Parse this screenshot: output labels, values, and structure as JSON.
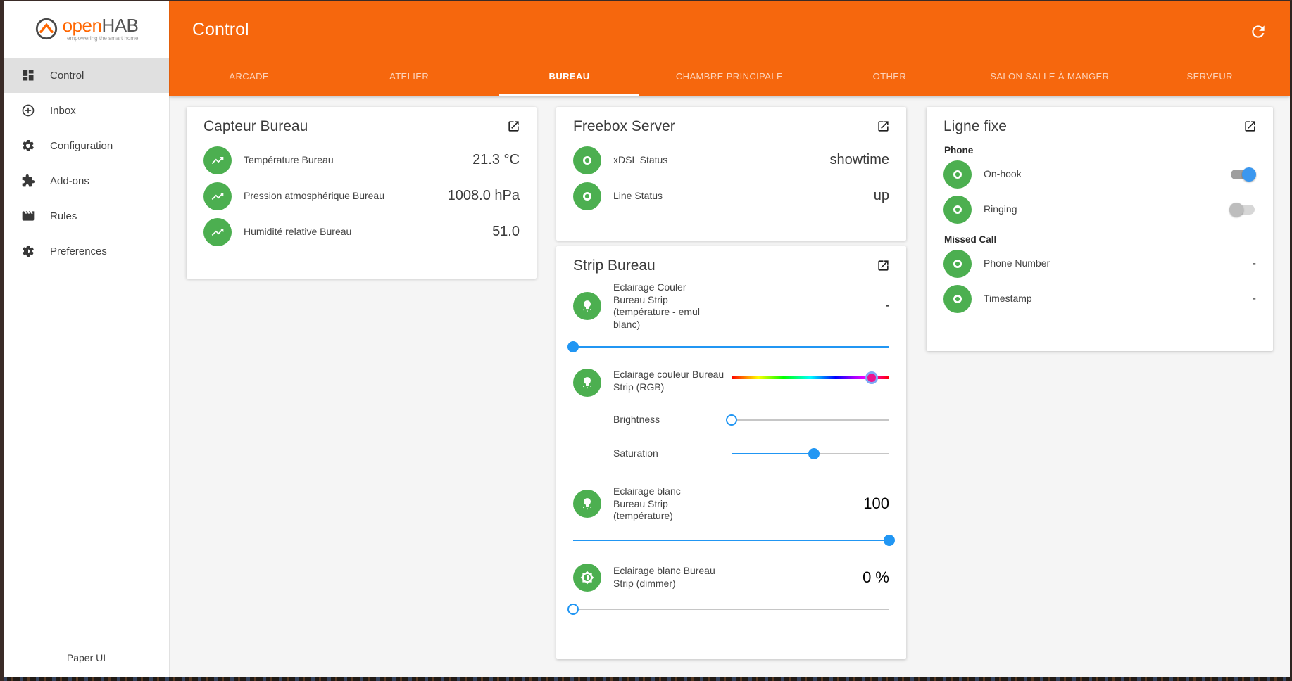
{
  "sidebar": {
    "logo": {
      "text_primary": "open",
      "text_secondary": "HAB",
      "tagline": "empowering the smart home"
    },
    "items": [
      {
        "label": "Control",
        "icon": "dashboard"
      },
      {
        "label": "Inbox",
        "icon": "add-circle"
      },
      {
        "label": "Configuration",
        "icon": "gear"
      },
      {
        "label": "Add-ons",
        "icon": "puzzle"
      },
      {
        "label": "Rules",
        "icon": "movie"
      },
      {
        "label": "Preferences",
        "icon": "gear-badge"
      }
    ],
    "footer": "Paper UI"
  },
  "header": {
    "title": "Control",
    "active_tab": "BUREAU",
    "tabs": [
      {
        "label": "ARCADE"
      },
      {
        "label": "ATELIER"
      },
      {
        "label": "BUREAU"
      },
      {
        "label": "CHAMBRE PRINCIPALE"
      },
      {
        "label": "OTHER"
      },
      {
        "label": "SALON SALLE À MANGER"
      },
      {
        "label": "SERVEUR"
      }
    ]
  },
  "cards": {
    "capteur": {
      "title": "Capteur Bureau",
      "rows": [
        {
          "icon": "trending-up",
          "label": "Température Bureau",
          "value": "21.3 °C"
        },
        {
          "icon": "trending-up",
          "label": "Pression atmosphérique Bureau",
          "value": "1008.0 hPa"
        },
        {
          "icon": "trending-up",
          "label": "Humidité relative Bureau",
          "value": "51.0"
        }
      ]
    },
    "freebox": {
      "title": "Freebox Server",
      "rows": [
        {
          "icon": "ring",
          "label": "xDSL Status",
          "value": "showtime"
        },
        {
          "icon": "ring",
          "label": "Line Status",
          "value": "up"
        }
      ]
    },
    "strip": {
      "title": "Strip Bureau",
      "emul": {
        "label": "Eclairage Couler Bureau Strip (température - emul blanc)",
        "value": "-",
        "percent": 0
      },
      "rgb": {
        "label": "Eclairage couleur Bureau Strip (RGB)",
        "percent": 89
      },
      "brightness": {
        "label": "Brightness",
        "percent": 0
      },
      "saturation": {
        "label": "Saturation",
        "percent": 52
      },
      "temperature": {
        "label": "Eclairage blanc Bureau Strip (température)",
        "value": "100",
        "percent": 100
      },
      "dimmer": {
        "label": "Eclairage blanc Bureau Strip (dimmer)",
        "value": "0 %",
        "percent": 0
      }
    },
    "ligne": {
      "title": "Ligne fixe",
      "section_phone": "Phone",
      "section_missed": "Missed Call",
      "rows": {
        "onhook": {
          "label": "On-hook",
          "on": true
        },
        "ringing": {
          "label": "Ringing",
          "on": false
        },
        "phone_number": {
          "label": "Phone Number",
          "value": "-"
        },
        "timestamp": {
          "label": "Timestamp",
          "value": "-"
        }
      }
    }
  },
  "colors": {
    "accent": "#f6670d",
    "green": "#4caf50",
    "blue": "#2196f3",
    "rgb_thumb": "#ec1390"
  }
}
